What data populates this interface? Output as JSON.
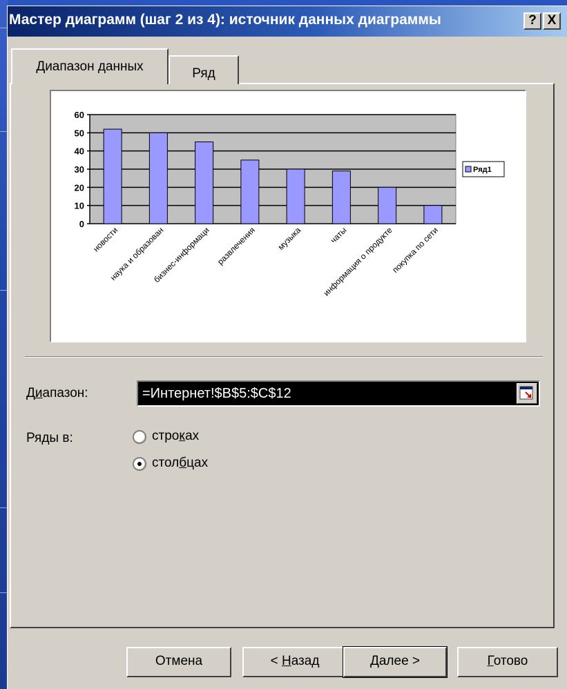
{
  "title": "Мастер диаграмм (шаг 2 из 4): источник данных диаграммы",
  "titlebar_buttons": {
    "help": "?",
    "close": "X"
  },
  "tabs": [
    {
      "label": "Диапазон данных",
      "active": true
    },
    {
      "label": "Ряд",
      "active": false
    }
  ],
  "range": {
    "label_pre": "Д",
    "label_u": "и",
    "label_post": "апазон:",
    "value": "=Интернет!$B$5:$C$12",
    "icon": "collapse-dialog-icon"
  },
  "series_in": {
    "label": "Ряды в:",
    "options": [
      {
        "pre": "стро",
        "u": "к",
        "post": "ах",
        "selected": false
      },
      {
        "pre": "стол",
        "u": "б",
        "post": "цах",
        "selected": true
      }
    ]
  },
  "buttons": {
    "cancel": "Отмена",
    "back_pre": "< ",
    "back_u": "Н",
    "back_post": "азад",
    "next_u": "Д",
    "next_post": "алее >",
    "finish_u": "Г",
    "finish_post": "отово"
  },
  "colors": {
    "bar": "#9999ff",
    "plot_area": "#c0c0c0",
    "title_gradient_start": "#0a246a",
    "title_gradient_end": "#a6caf0"
  },
  "chart_data": {
    "type": "bar",
    "categories": [
      "новости",
      "наука и образование",
      "бизнес-информация",
      "развлечения",
      "музыка",
      "чаты",
      "информация о продукте",
      "покупка по сети"
    ],
    "tick_labels": [
      "новости",
      "наука и образован",
      "бизнес-информаци",
      "развлечения",
      "музыка",
      "чаты",
      "информация о продукте",
      "покупка по сети"
    ],
    "series": [
      {
        "name": "Ряд1",
        "values": [
          52,
          50,
          45,
          35,
          30,
          29,
          20,
          10
        ]
      }
    ],
    "ylim": [
      0,
      60
    ],
    "yticks": [
      0,
      10,
      20,
      30,
      40,
      50,
      60
    ],
    "grid": true,
    "legend": "right"
  }
}
